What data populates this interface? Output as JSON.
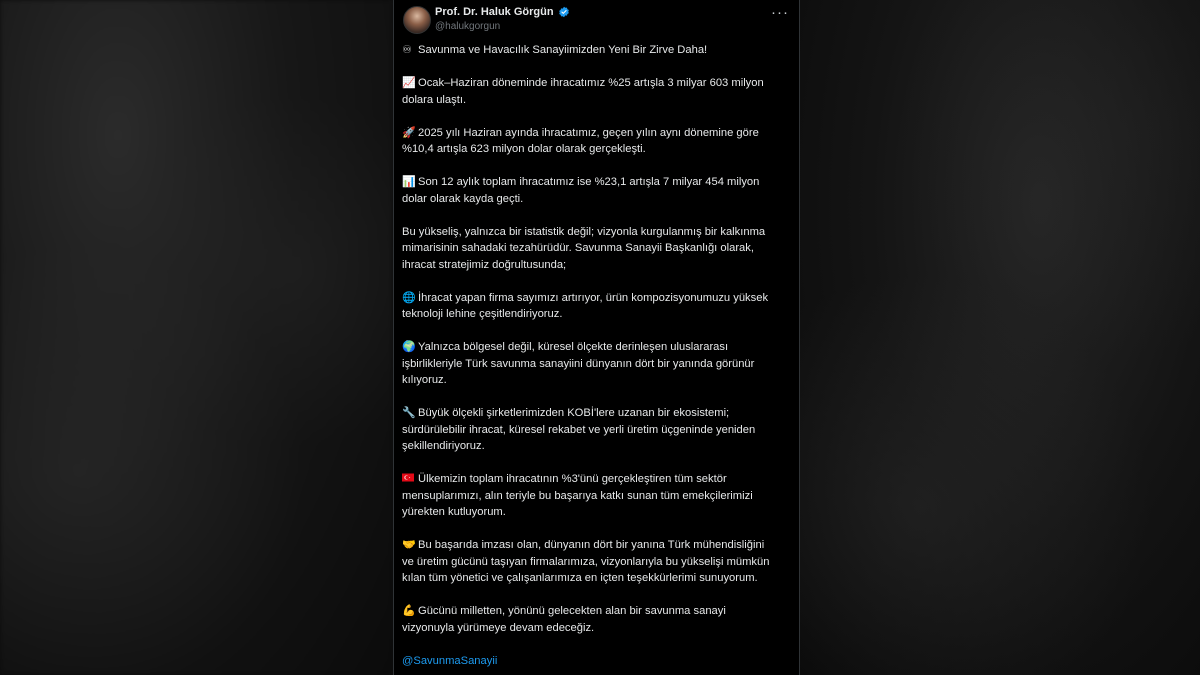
{
  "author": {
    "name": "Prof. Dr. Haluk Görgün",
    "handle": "@halukgorgun"
  },
  "menu_glyph": "···",
  "paragraphs": [
    {
      "icon": "infinity-emoji",
      "glyph": "♾",
      "lines": [
        "Savunma ve Havacılık Sanayiimizden Yeni Bir Zirve Daha!"
      ]
    },
    {
      "icon": "chart-increasing-emoji",
      "glyph": "📈",
      "lines": [
        "Ocak–Haziran döneminde ihracatımız %25 artışla 3 milyar 603 milyon",
        "dolara ulaştı."
      ]
    },
    {
      "icon": "rocket-emoji",
      "glyph": "🚀",
      "lines": [
        "2025 yılı Haziran ayında ihracatımız, geçen yılın aynı dönemine göre",
        "%10,4 artışla 623 milyon dolar olarak gerçekleşti."
      ]
    },
    {
      "icon": "bar-chart-emoji",
      "glyph": "📊",
      "lines": [
        "Son 12 aylık toplam ihracatımız ise %23,1 artışla 7 milyar 454 milyon",
        "dolar olarak kayda geçti."
      ]
    },
    {
      "icon": "",
      "glyph": "",
      "lines": [
        "Bu yükseliş, yalnızca bir istatistik değil; vizyonla kurgulanmış bir kalkınma",
        "mimarisinin sahadaki tezahürüdür. Savunma Sanayii Başkanlığı olarak,",
        "ihracat stratejimiz doğrultusunda;"
      ]
    },
    {
      "icon": "globe-meridians-emoji",
      "glyph": "🌐",
      "lines": [
        "İhracat yapan firma sayımızı artırıyor, ürün kompozisyonumuzu yüksek",
        "teknoloji lehine çeşitlendiriyoruz."
      ]
    },
    {
      "icon": "globe-earth-emoji",
      "glyph": "🌍",
      "lines": [
        "Yalnızca bölgesel değil, küresel ölçekte derinleşen uluslararası",
        "işbirlikleriyle Türk savunma sanayiini dünyanın dört bir yanında görünür",
        "kılıyoruz."
      ]
    },
    {
      "icon": "wrench-emoji",
      "glyph": "🔧",
      "lines": [
        "Büyük ölçekli şirketlerimizden KOBİ'lere uzanan bir ekosistemi;",
        "sürdürülebilir ihracat, küresel rekabet ve yerli üretim üçgeninde yeniden",
        "şekillendiriyoruz."
      ]
    },
    {
      "icon": "turkey-flag-emoji",
      "glyph": "",
      "lines": [
        "Ülkemizin toplam ihracatının %3'ünü gerçekleştiren tüm sektör",
        "mensuplarımızı, alın teriyle bu başarıya katkı sunan tüm emekçilerimizi",
        "yürekten kutluyorum."
      ]
    },
    {
      "icon": "handshake-emoji",
      "glyph": "🤝",
      "lines": [
        "Bu başarıda imzası olan, dünyanın dört bir yanına Türk mühendisliğini",
        "ve üretim gücünü taşıyan firmalarımıza, vizyonlarıyla bu yükselişi mümkün",
        "kılan tüm yönetici ve çalışanlarımıza en içten teşekkürlerimi sunuyorum."
      ]
    },
    {
      "icon": "flexed-biceps-emoji",
      "glyph": "💪",
      "lines": [
        "Gücünü milletten, yönünü gelecekten alan bir savunma sanayi",
        "vizyonuyla yürümeye devam edeceğiz."
      ]
    }
  ],
  "mention": "@SavunmaSanayii",
  "colors": {
    "background": "#000000",
    "text": "#e7e9ea",
    "muted": "#71767b",
    "link": "#1d9bf0",
    "verified": "#1d9bf0",
    "flag_red": "#e30a17"
  }
}
